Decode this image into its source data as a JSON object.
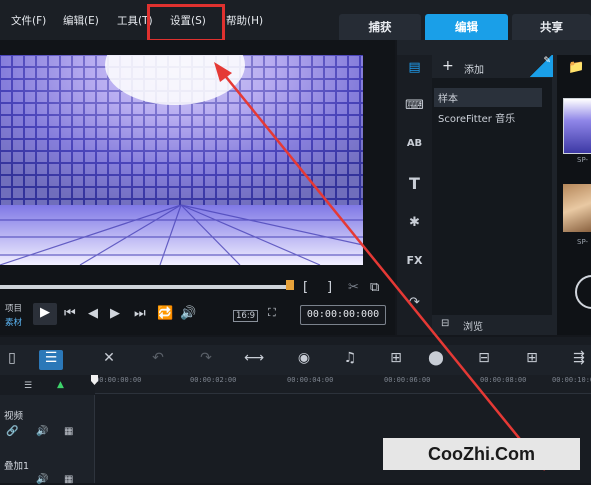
{
  "menu": {
    "items": [
      "文件(F)",
      "编辑(E)",
      "工具(T)",
      "设置(S)",
      "帮助(H)"
    ]
  },
  "tabs": {
    "capture": "捕获",
    "edit": "编辑",
    "share": "共享"
  },
  "preview": {
    "project_label": "项目",
    "clip_label": "素材",
    "aspect_ratio": "16:9",
    "timecode": "00:00:00:000",
    "bracket_in": "[",
    "bracket_out": "]"
  },
  "library": {
    "add_label": "添加",
    "items": [
      "样本",
      "ScoreFitter 音乐"
    ],
    "browse_label": "浏览",
    "thumb_labels": [
      "SP-",
      "SP-"
    ],
    "sidebar_text": {
      "title_icon": "T",
      "fx_icon": "FX",
      "ab_icon": "AB"
    }
  },
  "timeline": {
    "ruler_labels": [
      "00:00:00:00",
      "00:00:02:00",
      "00:00:04:00",
      "00:00:06:00",
      "00:00:08:00",
      "00:00:10:0"
    ],
    "tracks": [
      "视频",
      "叠加1"
    ]
  },
  "watermark": "CooZhi.Com",
  "colors": {
    "highlight": "#e0312f",
    "accent": "#1a9fe8",
    "arrow": "#e53935"
  }
}
